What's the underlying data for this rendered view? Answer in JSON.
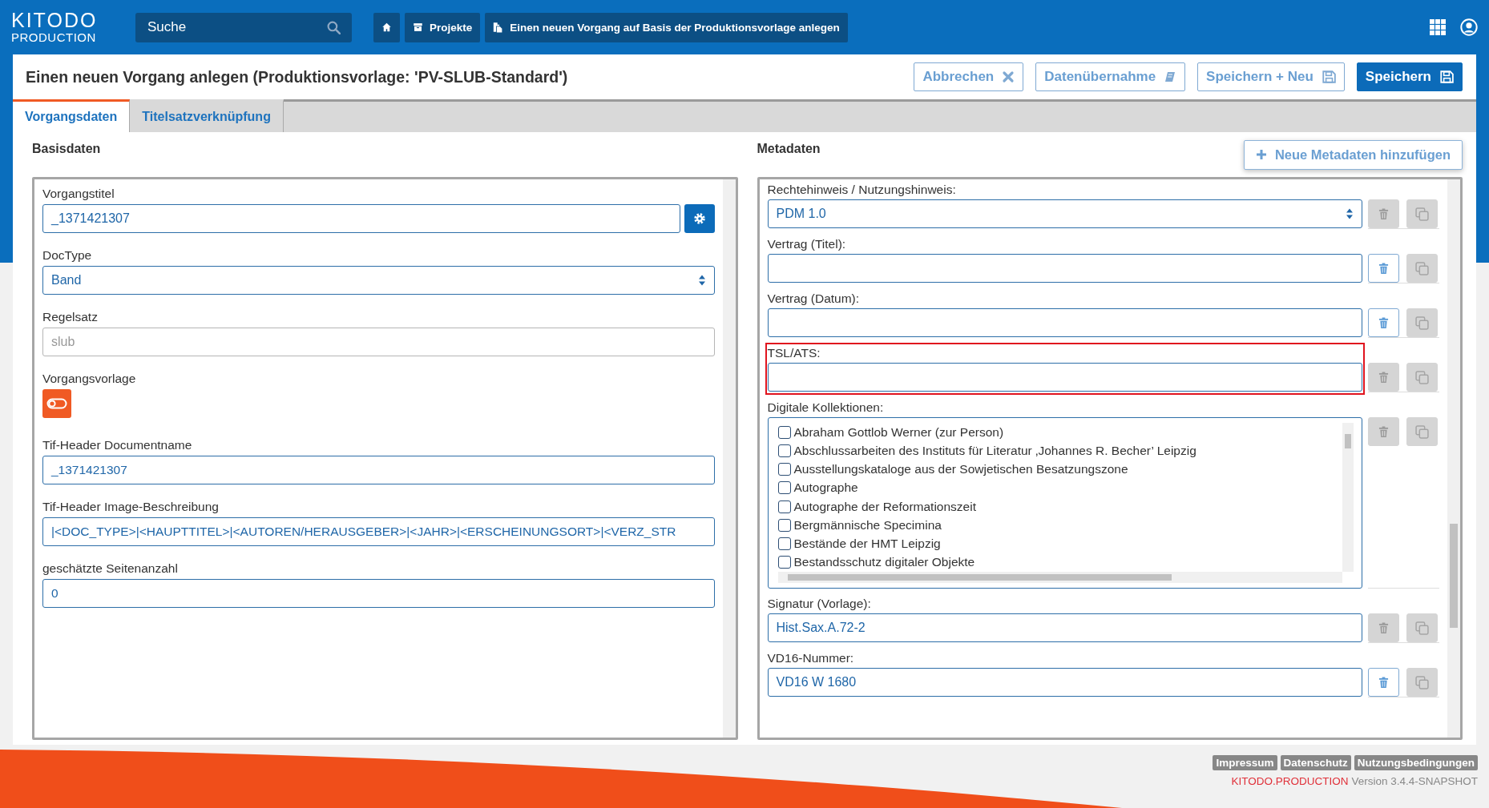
{
  "header": {
    "logo_top": "KITODO",
    "logo_bottom": "PRODUCTION",
    "search": {
      "placeholder": "Suche"
    },
    "breadcrumbs": [
      {
        "kind": "home"
      },
      {
        "kind": "projects",
        "label": "Projekte"
      },
      {
        "kind": "current",
        "label": "Einen neuen Vorgang auf Basis der Produktionsvorlage anlegen"
      }
    ]
  },
  "page": {
    "title": "Einen neuen Vorgang anlegen (Produktionsvorlage: 'PV-SLUB-Standard')",
    "buttons": [
      {
        "label": "Abbrechen",
        "kind": "cancel",
        "primary": false
      },
      {
        "label": "Datenübernahme",
        "kind": "import",
        "primary": false
      },
      {
        "label": "Speichern + Neu",
        "kind": "save",
        "primary": false
      },
      {
        "label": "Speichern",
        "kind": "save",
        "primary": true
      }
    ]
  },
  "tabs": [
    {
      "label": "Vorgangsdaten",
      "selected": true
    },
    {
      "label": "Titelsatzverknüpfung",
      "selected": false
    }
  ],
  "basisdaten": {
    "heading": "Basisdaten",
    "fields": [
      {
        "label": "Vorgangstitel",
        "kind": "text-action",
        "value": "_1371421307"
      },
      {
        "label": "DocType",
        "kind": "select",
        "value": "Band"
      },
      {
        "label": "Regelsatz",
        "kind": "readonly",
        "value": "slub"
      },
      {
        "label": "Vorgangsvorlage",
        "kind": "switch",
        "on": false
      },
      {
        "label": "Tif-Header Documentname",
        "kind": "text",
        "value": "_1371421307"
      },
      {
        "label": "Tif-Header Image-Beschreibung",
        "kind": "text",
        "value": "|<DOC_TYPE>|<HAUPTTITEL>|<AUTOREN/HERAUSGEBER>|<JAHR>|<ERSCHEINUNGSORT>|<VERZ_STR"
      },
      {
        "label": "geschätzte Seitenanzahl",
        "kind": "text",
        "value": "0"
      }
    ]
  },
  "metadaten": {
    "heading": "Metadaten",
    "add_button": "Neue Metadaten hinzufügen",
    "rows": [
      {
        "label": "Rechtehinweis / Nutzungshinweis:",
        "kind": "select",
        "value": "PDM 1.0",
        "delete_disabled": true,
        "highlighted": false
      },
      {
        "label": "Vertrag (Titel):",
        "kind": "text",
        "delete_disabled": false,
        "highlighted": false
      },
      {
        "label": "Vertrag (Datum):",
        "kind": "text",
        "delete_disabled": false,
        "highlighted": false
      },
      {
        "label": "TSL/ATS:",
        "kind": "text",
        "delete_disabled": true,
        "highlighted": true
      },
      {
        "label": "Digitale Kollektionen:",
        "kind": "checklist",
        "delete_disabled": true,
        "highlighted": false,
        "options": [
          {
            "label": "Abraham Gottlob Werner (zur Person)",
            "checked": false
          },
          {
            "label": "Abschlussarbeiten des Instituts für Literatur ‚Johannes R. Becher’ Leipzig",
            "checked": false
          },
          {
            "label": "Ausstellungskataloge aus der Sowjetischen Besatzungszone",
            "checked": false
          },
          {
            "label": "Autographe",
            "checked": false
          },
          {
            "label": "Autographe der Reformationszeit",
            "checked": false
          },
          {
            "label": "Bergmännische Specimina",
            "checked": false
          },
          {
            "label": "Bestände der HMT Leipzig",
            "checked": false
          },
          {
            "label": "Bestandsschutz digitaler Objekte",
            "checked": false
          }
        ]
      },
      {
        "label": "Signatur (Vorlage):",
        "kind": "text",
        "value": "Hist.Sax.A.72-2",
        "delete_disabled": true,
        "highlighted": false
      },
      {
        "label": "VD16-Nummer:",
        "kind": "text",
        "value": "VD16 W 1680",
        "delete_disabled": false,
        "highlighted": false
      }
    ]
  },
  "footer": {
    "links": [
      "Impressum",
      "Datenschutz",
      "Nutzungsbedingungen"
    ],
    "brand": "KITODO.PRODUCTION",
    "version": "Version 3.4.4-SNAPSHOT"
  }
}
